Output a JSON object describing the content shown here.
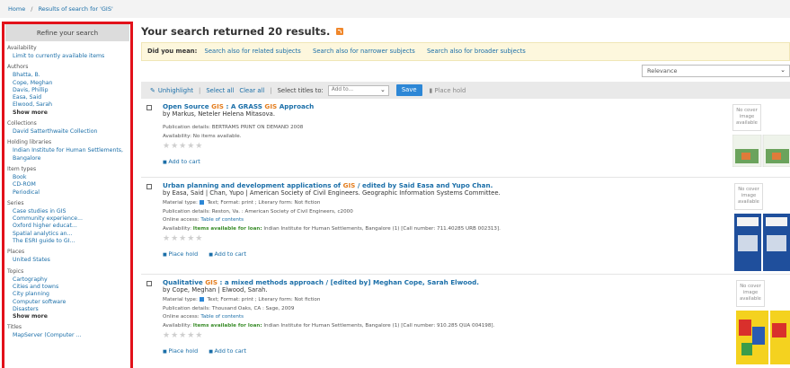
{
  "breadcrumb": {
    "home": "Home",
    "current": "Results of search for 'GIS'"
  },
  "sidebar": {
    "title": "Refine your search",
    "facets": [
      {
        "title": "Availability",
        "items": [
          "Limit to currently available items"
        ]
      },
      {
        "title": "Authors",
        "items": [
          "Bhatta, B.",
          "Cope, Meghan",
          "Davis, Phillip",
          "Easa, Said",
          "Elwood, Sarah"
        ],
        "more": "Show more"
      },
      {
        "title": "Collections",
        "items": [
          "David Satterthwaite Collection"
        ]
      },
      {
        "title": "Holding libraries",
        "items": [
          "Indian Institute for Human Settlements,",
          "Bangalore"
        ]
      },
      {
        "title": "Item types",
        "items": [
          "Book",
          "CD-ROM",
          "Periodical"
        ]
      },
      {
        "title": "Series",
        "items": [
          "Case studies in GIS",
          "Community experience...",
          "Oxford higher educat...",
          "Spatial analytics an...",
          "The ESRI guide to GI..."
        ]
      },
      {
        "title": "Places",
        "items": [
          "United States"
        ]
      },
      {
        "title": "Topics",
        "items": [
          "Cartography",
          "Cities and towns",
          "City planning",
          "Computer software",
          "Disasters"
        ],
        "more": "Show more"
      },
      {
        "title": "Titles",
        "items": [
          "MapServer (Computer ..."
        ]
      }
    ]
  },
  "main": {
    "results_title": "Your search returned 20 results.",
    "did_you_mean": {
      "label": "Did you mean:",
      "links": [
        "Search also for related subjects",
        "Search also for narrower subjects",
        "Search also for broader subjects"
      ]
    },
    "sort": {
      "selected": "Relevance"
    },
    "toolbar": {
      "unhighlight": "Unhighlight",
      "select_all": "Select all",
      "clear_all": "Clear all",
      "select_titles": "Select titles to:",
      "add_to": "Add to...",
      "save": "Save",
      "place_hold": "Place hold"
    },
    "results": [
      {
        "title_pre": "Open Source ",
        "title_hl": "GIS",
        "title_mid": " : A GRASS ",
        "title_hl2": "GIS",
        "title_post": " Approach",
        "by": "by Markus, Neteler Helena Mitasova.",
        "pub": "Publication details: BERTRAMS PRINT ON DEMAND 2008",
        "avail": "Availability: No items available.",
        "actions": [
          "Add to cart"
        ],
        "no_cover": "No cover image available"
      },
      {
        "title_pre": "Urban planning and development applications of ",
        "title_hl": "GIS",
        "title_post": " / edited by Said Easa and Yupo Chan.",
        "by": "by Easa, Said | Chan, Yupo | American Society of Civil Engineers. Geographic Information Systems Committee.",
        "material": "Material type:",
        "material_val": "Text; Format: print ; Literary form: Not fiction",
        "pub": "Publication details: Reston, Va. : American Society of Civil Engineers, c2000",
        "online": "Online access: ",
        "online_link": "Table of contents",
        "avail_label": "Availability: ",
        "avail_green": "Items available for loan:",
        "avail_rest": " Indian Institute for Human Settlements, Bangalore (1) [Call number: 711.40285 URB 002313].",
        "actions": [
          "Place hold",
          "Add to cart"
        ],
        "no_cover": "No cover image available"
      },
      {
        "title_pre": "Qualitative ",
        "title_hl": "GIS",
        "title_post": " : a mixed methods approach / [edited by] Meghan Cope, Sarah Elwood.",
        "by": "by Cope, Meghan | Elwood, Sarah.",
        "material": "Material type:",
        "material_val": "Text; Format: print ; Literary form: Not fiction",
        "pub": "Publication details: Thousand Oaks, CA : Sage, 2009",
        "online": "Online access: ",
        "online_link": "Table of contents",
        "avail_label": "Availability: ",
        "avail_green": "Items available for loan:",
        "avail_rest": " Indian Institute for Human Settlements, Bangalore (1) [Call number: 910.285 QUA 004198].",
        "actions": [
          "Place hold",
          "Add to cart"
        ],
        "no_cover": "No cover image available"
      }
    ],
    "stars": "★★★★★",
    "colors": {
      "accent": "#1a6ea8",
      "highlight": "#e47d1e",
      "save": "#2d87d6",
      "sidebar_border": "#e2111a"
    }
  }
}
